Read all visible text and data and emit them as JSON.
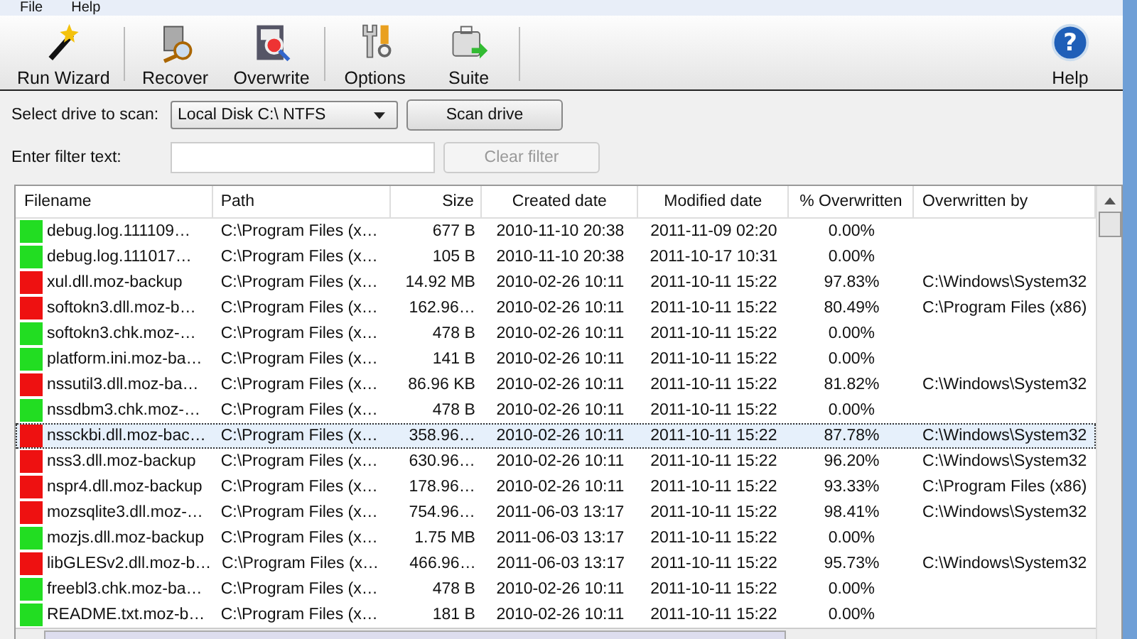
{
  "menu": [
    {
      "label": "File"
    },
    {
      "label": "Help"
    }
  ],
  "toolbar": [
    {
      "label": "Run Wizard",
      "kind": "wand"
    },
    {
      "label": "Recover",
      "kind": "recover"
    },
    {
      "label": "Overwrite",
      "kind": "overwrite"
    },
    {
      "label": "Options",
      "kind": "options"
    },
    {
      "label": "Suite",
      "kind": "suite"
    }
  ],
  "help_button": {
    "label": "Help",
    "icon": "?"
  },
  "drive": {
    "label": "Select drive to scan:",
    "value": "Local Disk C:\\ NTFS",
    "button": "Scan drive"
  },
  "filter": {
    "label": "Enter filter text:",
    "button": "Clear filter",
    "button_disabled": true
  },
  "table": {
    "columns": [
      "Filename",
      "Path",
      "Size",
      "Created date",
      "Modified date",
      "% Overwritten",
      "Overwritten by"
    ],
    "rows": [
      {
        "color": "#22dd22",
        "selected": false,
        "cells": [
          "debug.log.111109…",
          "C:\\Program Files (x…",
          "677 B",
          "2010-11-10 20:38",
          "2011-11-09 02:20",
          "0.00%",
          ""
        ]
      },
      {
        "color": "#22dd22",
        "selected": false,
        "cells": [
          "debug.log.111017…",
          "C:\\Program Files (x…",
          "105 B",
          "2010-11-10 20:38",
          "2011-10-17 10:31",
          "0.00%",
          ""
        ]
      },
      {
        "color": "#ee1111",
        "selected": false,
        "cells": [
          "xul.dll.moz-backup",
          "C:\\Program Files (x…",
          "14.92 MB",
          "2010-02-26 10:11",
          "2011-10-11 15:22",
          "97.83%",
          "C:\\Windows\\System32"
        ]
      },
      {
        "color": "#ee1111",
        "selected": false,
        "cells": [
          "softokn3.dll.moz-b…",
          "C:\\Program Files (x…",
          "162.96…",
          "2010-02-26 10:11",
          "2011-10-11 15:22",
          "80.49%",
          "C:\\Program Files (x86)"
        ]
      },
      {
        "color": "#22dd22",
        "selected": false,
        "cells": [
          "softokn3.chk.moz-…",
          "C:\\Program Files (x…",
          "478 B",
          "2010-02-26 10:11",
          "2011-10-11 15:22",
          "0.00%",
          ""
        ]
      },
      {
        "color": "#22dd22",
        "selected": false,
        "cells": [
          "platform.ini.moz-ba…",
          "C:\\Program Files (x…",
          "141 B",
          "2010-02-26 10:11",
          "2011-10-11 15:22",
          "0.00%",
          ""
        ]
      },
      {
        "color": "#ee1111",
        "selected": false,
        "cells": [
          "nssutil3.dll.moz-ba…",
          "C:\\Program Files (x…",
          "86.96 KB",
          "2010-02-26 10:11",
          "2011-10-11 15:22",
          "81.82%",
          "C:\\Windows\\System32"
        ]
      },
      {
        "color": "#22dd22",
        "selected": false,
        "cells": [
          "nssdbm3.chk.moz-…",
          "C:\\Program Files (x…",
          "478 B",
          "2010-02-26 10:11",
          "2011-10-11 15:22",
          "0.00%",
          ""
        ]
      },
      {
        "color": "#ee1111",
        "selected": true,
        "cells": [
          "nssckbi.dll.moz-bac…",
          "C:\\Program Files (x…",
          "358.96…",
          "2010-02-26 10:11",
          "2011-10-11 15:22",
          "87.78%",
          "C:\\Windows\\System32"
        ]
      },
      {
        "color": "#ee1111",
        "selected": false,
        "cells": [
          "nss3.dll.moz-backup",
          "C:\\Program Files (x…",
          "630.96…",
          "2010-02-26 10:11",
          "2011-10-11 15:22",
          "96.20%",
          "C:\\Windows\\System32"
        ]
      },
      {
        "color": "#ee1111",
        "selected": false,
        "cells": [
          "nspr4.dll.moz-backup",
          "C:\\Program Files (x…",
          "178.96…",
          "2010-02-26 10:11",
          "2011-10-11 15:22",
          "93.33%",
          "C:\\Program Files (x86)"
        ]
      },
      {
        "color": "#ee1111",
        "selected": false,
        "cells": [
          "mozsqlite3.dll.moz-…",
          "C:\\Program Files (x…",
          "754.96…",
          "2011-06-03 13:17",
          "2011-10-11 15:22",
          "98.41%",
          "C:\\Windows\\System32"
        ]
      },
      {
        "color": "#22dd22",
        "selected": false,
        "cells": [
          "mozjs.dll.moz-backup",
          "C:\\Program Files (x…",
          "1.75 MB",
          "2011-06-03 13:17",
          "2011-10-11 15:22",
          "0.00%",
          ""
        ]
      },
      {
        "color": "#ee1111",
        "selected": false,
        "cells": [
          "libGLESv2.dll.moz-b…",
          "C:\\Program Files (x…",
          "466.96…",
          "2011-06-03 13:17",
          "2011-10-11 15:22",
          "95.73%",
          "C:\\Windows\\System32"
        ]
      },
      {
        "color": "#22dd22",
        "selected": false,
        "cells": [
          "freebl3.chk.moz-ba…",
          "C:\\Program Files (x…",
          "478 B",
          "2010-02-26 10:11",
          "2011-10-11 15:22",
          "0.00%",
          ""
        ]
      },
      {
        "color": "#22dd22",
        "selected": false,
        "cells": [
          "README.txt.moz-b…",
          "C:\\Program Files (x…",
          "181 B",
          "2010-02-26 10:11",
          "2011-10-11 15:22",
          "0.00%",
          ""
        ]
      }
    ]
  }
}
